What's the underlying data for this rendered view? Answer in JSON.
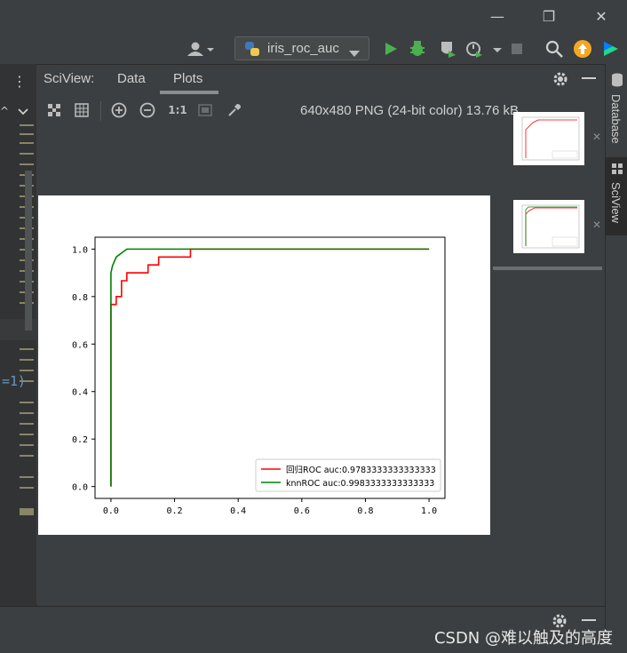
{
  "window": {
    "minimize_glyph": "—",
    "maximize_glyph": "❐",
    "close_glyph": "✕"
  },
  "runbar": {
    "config_name": "iris_roc_auc"
  },
  "sciview": {
    "title": "SciView:",
    "tabs": [
      {
        "label": "Data",
        "active": false
      },
      {
        "label": "Plots",
        "active": true
      }
    ],
    "zoom_reset_label": "1:1",
    "image_info": "640x480 PNG (24-bit color) 13.76 kB"
  },
  "sidebar_right": {
    "tabs": [
      {
        "label": "Database"
      },
      {
        "label": "SciView",
        "active": true
      }
    ]
  },
  "left_gutter": {
    "code_fragment": "=1)"
  },
  "watermark": "CSDN @难以触及的高度",
  "chart_data": {
    "type": "line",
    "title": "",
    "xlabel": "",
    "ylabel": "",
    "xlim": [
      -0.05,
      1.05
    ],
    "ylim": [
      -0.05,
      1.05
    ],
    "xticks": [
      "0.0",
      "0.2",
      "0.4",
      "0.6",
      "0.8",
      "1.0"
    ],
    "yticks": [
      "0.0",
      "0.2",
      "0.4",
      "0.6",
      "0.8",
      "1.0"
    ],
    "legend_position": "lower-right",
    "series": [
      {
        "name": "回归ROC auc:0.9783333333333333",
        "color": "#ff0000",
        "x": [
          0.0,
          0.0,
          0.0,
          0.0167,
          0.0167,
          0.0333,
          0.0333,
          0.05,
          0.05,
          0.0667,
          0.0667,
          0.1167,
          0.1167,
          0.15,
          0.15,
          0.25,
          0.25,
          1.0
        ],
        "y": [
          0.0,
          0.4,
          0.7667,
          0.7667,
          0.8,
          0.8,
          0.8667,
          0.8667,
          0.9,
          0.9,
          0.9,
          0.9,
          0.9333,
          0.9333,
          0.9667,
          0.9667,
          1.0,
          1.0
        ]
      },
      {
        "name": "knnROC auc:0.9983333333333333",
        "color": "#008000",
        "x": [
          0.0,
          0.0,
          0.005,
          0.017,
          0.033,
          0.05,
          1.0
        ],
        "y": [
          0.0,
          0.9,
          0.93,
          0.967,
          0.983,
          1.0,
          1.0
        ]
      }
    ]
  },
  "colors": {
    "bg": "#3c3f41",
    "run_green": "#4caf50",
    "accent_orange": "#f5a623",
    "tab_underline": "#8a8c8e"
  }
}
